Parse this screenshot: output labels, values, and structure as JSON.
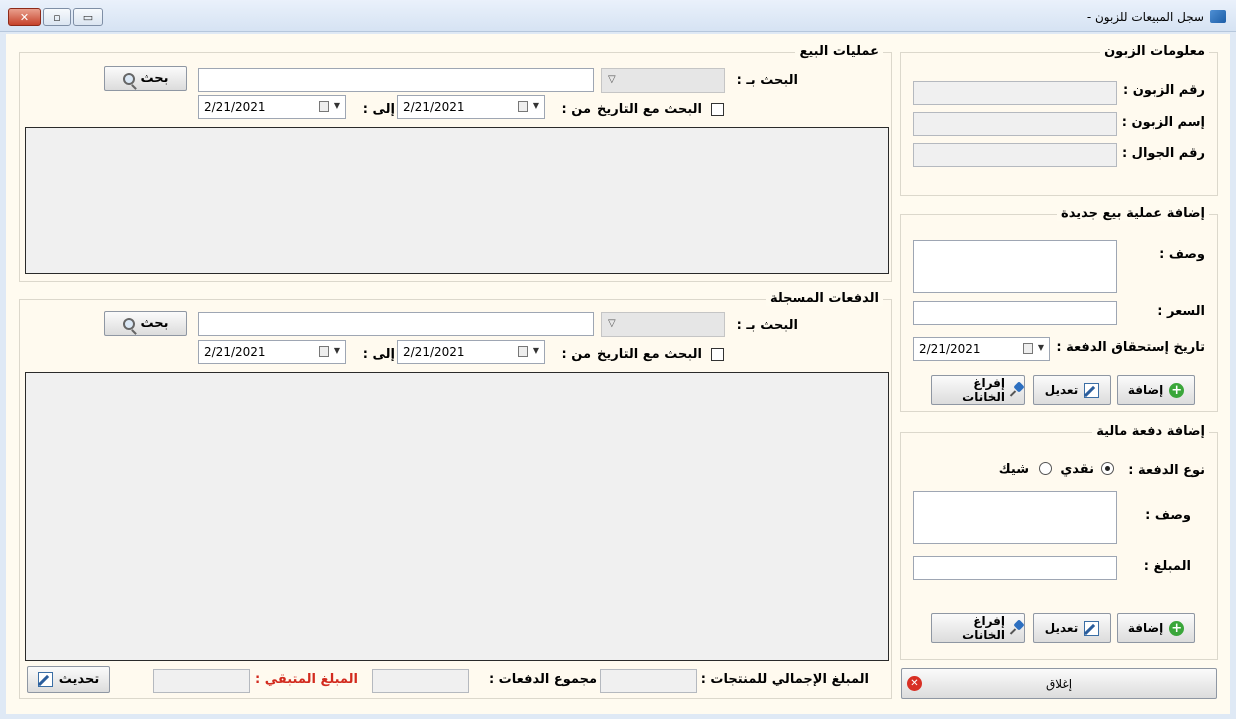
{
  "window": {
    "title": "سجل المبيعات للزبون -",
    "controls": {
      "close": "✕",
      "maximize": "▫",
      "minimize": "▭"
    }
  },
  "customer_info": {
    "title": "معلومات الزبون",
    "customer_number_label": "رقم الزبون :",
    "customer_name_label": "إسم الزبون :",
    "mobile_label": "رقم الجوال :"
  },
  "new_sale": {
    "title": "إضافة عملية بيع جديدة",
    "description_label": "وصف :",
    "price_label": "السعر :",
    "due_date_label": "تاريخ إستحقاق الدفعة :",
    "due_date_value": "2/21/2021",
    "add_label": "إضافة",
    "edit_label": "تعديل",
    "clear_label": "إفراغ الخانات"
  },
  "new_payment": {
    "title": "إضافة دفعة مالية",
    "payment_type_label": "نوع الدفعة :",
    "cash_label": "نقدي",
    "check_label": "شيك",
    "cash_selected": true,
    "description_label": "وصف :",
    "amount_label": "المبلغ :",
    "add_label": "إضافة",
    "edit_label": "تعديل",
    "clear_label": "إفراغ الخانات"
  },
  "sales_ops": {
    "title": "عمليات البيع",
    "search_by_label": "البحث بـ :",
    "search_button": "بحث",
    "search_with_date_label": "البحث مع التاريخ",
    "from_label": "من :",
    "to_label": "إلى :",
    "from_date": "2/21/2021",
    "to_date": "2/21/2021"
  },
  "payments": {
    "title": "الدفعات المسجلة",
    "search_by_label": "البحث بـ :",
    "search_button": "بحث",
    "search_with_date_label": "البحث مع التاريخ",
    "from_label": "من :",
    "to_label": "إلى :",
    "from_date": "2/21/2021",
    "to_date": "2/21/2021"
  },
  "footer": {
    "total_products_label": "المبلغ الإجمالي للمنتجات :",
    "total_payments_label": "مجموع الدفعات :",
    "remaining_label": "المبلغ المتبقي :",
    "refresh_label": "تحديث",
    "close_label": "إغلاق"
  },
  "colors": {
    "remaining_label": "#d22a1e",
    "add_icon": "#3aa63a",
    "close_icon": "#d82f24"
  }
}
